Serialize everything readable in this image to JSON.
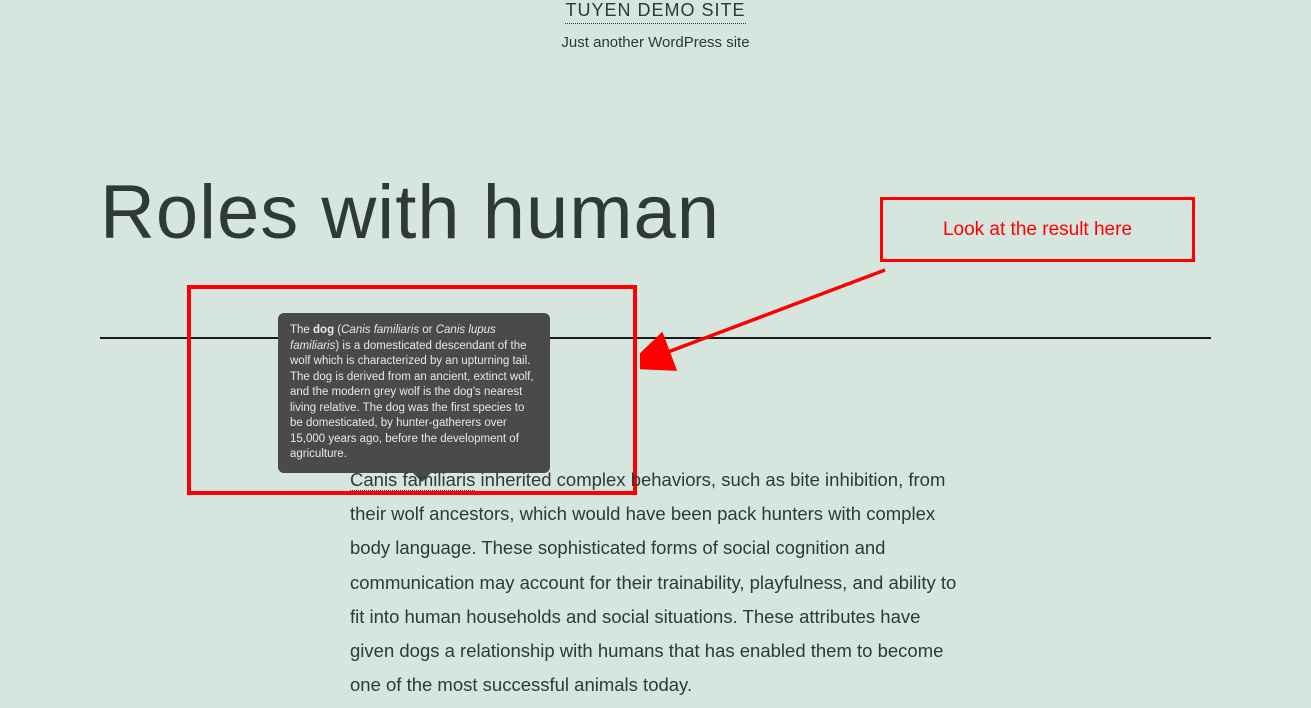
{
  "header": {
    "site_title": "TUYEN DEMO SITE",
    "tagline": "Just another WordPress site"
  },
  "page": {
    "title": "Roles with human"
  },
  "callout": {
    "text": "Look at the result here"
  },
  "tooltip": {
    "pre": "The ",
    "bold1": "dog",
    "mid1": " (",
    "ital1": "Canis familiaris",
    "mid2": " or ",
    "ital2": "Canis lupus familiaris",
    "rest": ") is a domesticated descendant of the wolf which is characterized by an upturning tail. The dog is derived from an ancient, extinct wolf, and the modern grey wolf is the dog's nearest living relative. The dog was the first species to be domesticated, by hunter-gatherers over 15,000 years ago, before the development of agriculture."
  },
  "article": {
    "term": "Canis familiaris",
    "body_rest": " inherited complex behaviors, such as bite inhibition, from their wolf ancestors, which would have been pack hunters with complex body language. These sophisticated forms of social cognition and communication may account for their trainability, playfulness, and ability to fit into human households and social situations. These attributes have given dogs a relationship with humans that has enabled them to become one of the most successful animals today."
  }
}
